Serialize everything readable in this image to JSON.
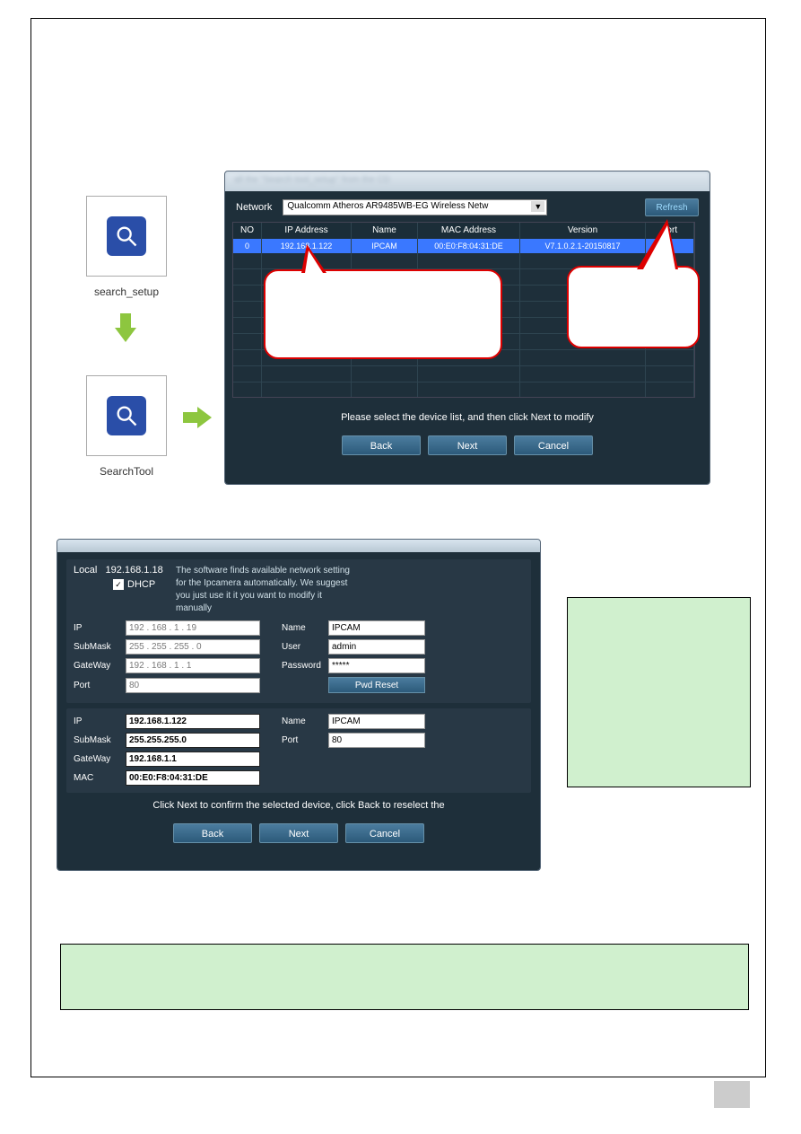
{
  "left_icons": {
    "setup_caption": "search_setup",
    "tool_caption": "SearchTool"
  },
  "win1": {
    "blur_text": "all the \"Search tool_setup\" from the CD",
    "network_label": "Network",
    "network_select": "Qualcomm Atheros AR9485WB-EG Wireless Netw",
    "refresh": "Refresh",
    "cols": {
      "no": "NO",
      "ip": "IP Address",
      "name": "Name",
      "mac": "MAC Address",
      "ver": "Version",
      "port": "port"
    },
    "row0": {
      "no": "0",
      "ip": "192.168.1.122",
      "name": "IPCAM",
      "mac": "00:E0:F8:04:31:DE",
      "ver": "V7.1.0.2.1-20150817",
      "port": ""
    },
    "instruction": "Please select the device list, and then click Next to modify",
    "back": "Back",
    "next": "Next",
    "cancel": "Cancel"
  },
  "win2": {
    "local_label": "Local",
    "local_ip": "192.168.1.18",
    "dhcp": "DHCP",
    "info": "The software finds available network setting for the Ipcamera automatically. We suggest you just use it it you want to modify it manually",
    "sec1": {
      "ip_lbl": "IP",
      "ip": "192 . 168 .  1  .  19",
      "subm_lbl": "SubMask",
      "subm": "255 . 255 . 255 .  0",
      "gw_lbl": "GateWay",
      "gw": "192 . 168 .  1  .  1",
      "port_lbl": "Port",
      "port": "80",
      "name_lbl": "Name",
      "name": "IPCAM",
      "user_lbl": "User",
      "user": "admin",
      "pwd_lbl": "Password",
      "pwd": "*****",
      "pwd_reset": "Pwd Reset"
    },
    "sec2": {
      "ip_lbl": "IP",
      "ip": "192.168.1.122",
      "subm_lbl": "SubMask",
      "subm": "255.255.255.0",
      "gw_lbl": "GateWay",
      "gw": "192.168.1.1",
      "mac_lbl": "MAC",
      "mac": "00:E0:F8:04:31:DE",
      "name_lbl": "Name",
      "name": "IPCAM",
      "port_lbl": "Port",
      "port": "80"
    },
    "instruction": "Click Next to confirm the selected device, click Back to reselect the",
    "back": "Back",
    "next": "Next",
    "cancel": "Cancel"
  }
}
